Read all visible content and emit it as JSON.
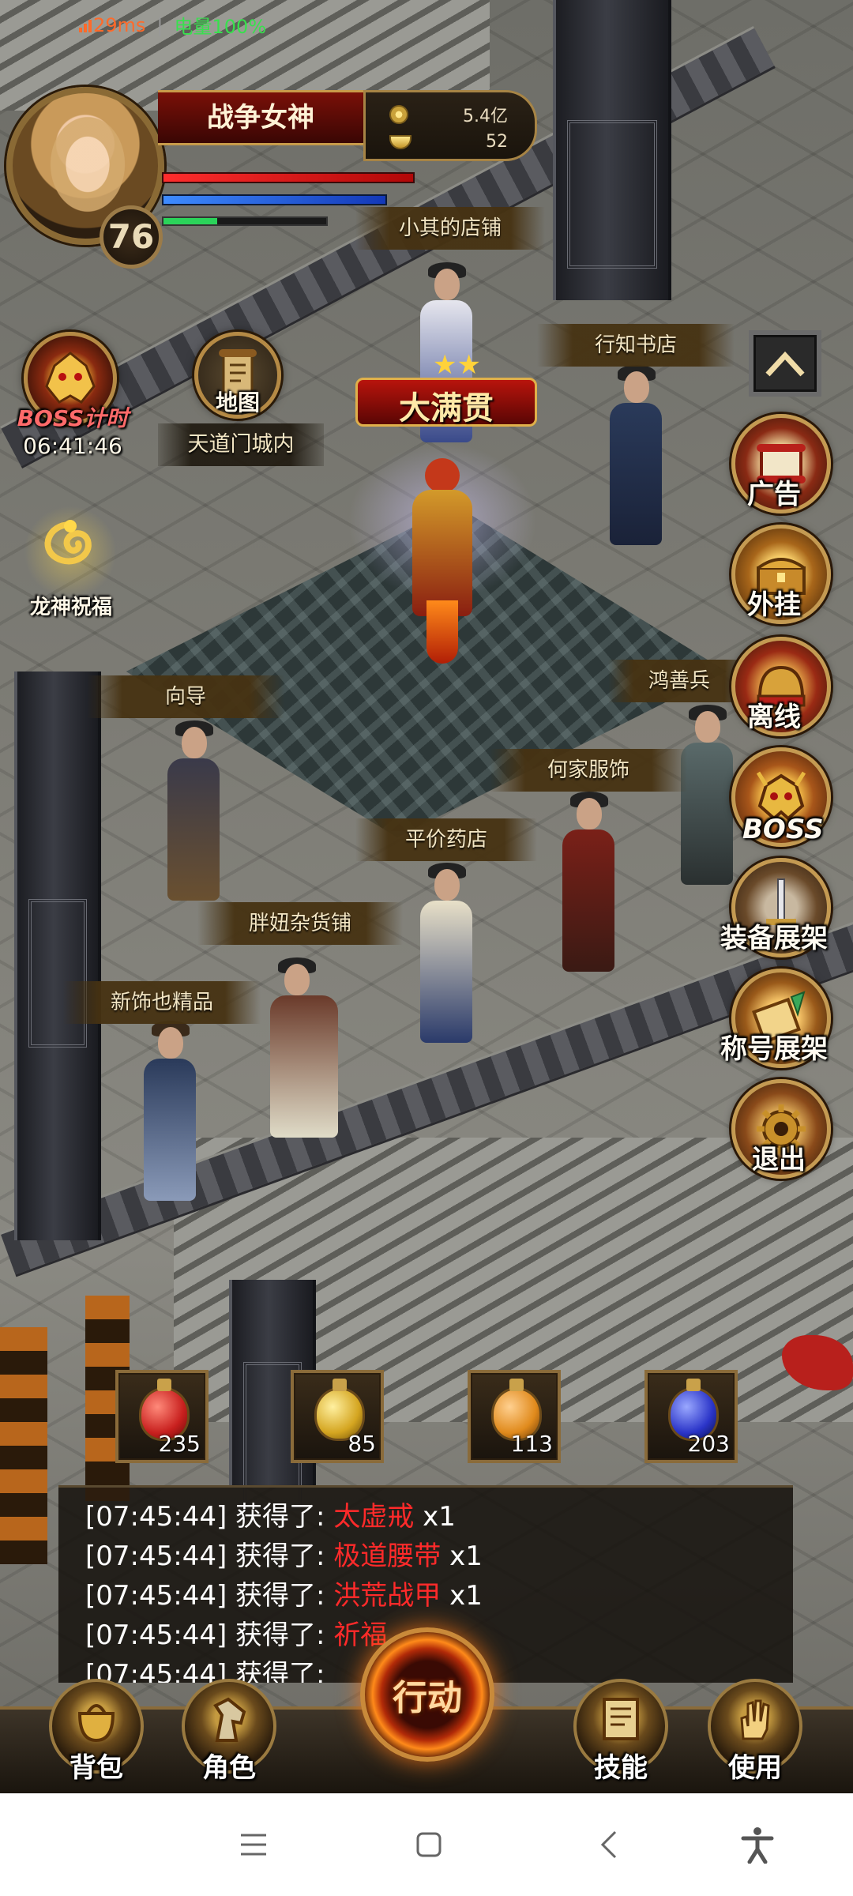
{
  "status": {
    "ping": "29ms",
    "battery": "电量100%"
  },
  "player": {
    "name": "战争女神",
    "level": "76",
    "gold": "5.4亿",
    "ingot": "52",
    "hp_fraction": 1.0,
    "mp_fraction": 0.95,
    "xp_fraction": 0.33
  },
  "left_icons": {
    "boss_timer": {
      "label": "BOSS计时",
      "time": "06:41:46"
    },
    "map": {
      "label": "地图",
      "location": "天道门城内"
    },
    "blessing": {
      "label": "龙神祝福"
    }
  },
  "npc_labels": [
    "小其的店铺",
    "行知书店",
    "向导",
    "鸿善兵",
    "何家服饰",
    "平价药店",
    "胖妞杂货铺",
    "新饰也精品"
  ],
  "title_banner": "大满贯",
  "right_menu": [
    {
      "label": "广告",
      "icon": "scroll-icon"
    },
    {
      "label": "外挂",
      "icon": "chest-icon"
    },
    {
      "label": "离线",
      "icon": "helmet-icon"
    },
    {
      "label": "BOSS",
      "icon": "demon-icon"
    },
    {
      "label": "装备展架",
      "icon": "sword-icon"
    },
    {
      "label": "称号展架",
      "icon": "scroll-quill-icon"
    },
    {
      "label": "退出",
      "icon": "gear-icon"
    }
  ],
  "potions": [
    {
      "count": "235",
      "color": "#c8201e"
    },
    {
      "count": "85",
      "color": "#d4a520"
    },
    {
      "count": "113",
      "color": "#e08a1c"
    },
    {
      "count": "203",
      "color": "#2a34c8"
    }
  ],
  "chat_log": [
    {
      "time": "[07:45:44]",
      "text": "获得了: ",
      "item": "太虚戒",
      "qty": "x1"
    },
    {
      "time": "[07:45:44]",
      "text": "获得了: ",
      "item": "极道腰带",
      "qty": "x1"
    },
    {
      "time": "[07:45:44]",
      "text": "获得了: ",
      "item": "洪荒战甲",
      "qty": "x1"
    },
    {
      "time": "[07:45:44]",
      "text": "获得了: ",
      "item": "祈福",
      "qty": ""
    },
    {
      "time": "[07:45:44]",
      "text": "获得了: ",
      "item": "",
      "qty": ""
    }
  ],
  "bottom_bar": {
    "bag": "背包",
    "character": "角色",
    "action": "行动",
    "skills": "技能",
    "use": "使用"
  }
}
